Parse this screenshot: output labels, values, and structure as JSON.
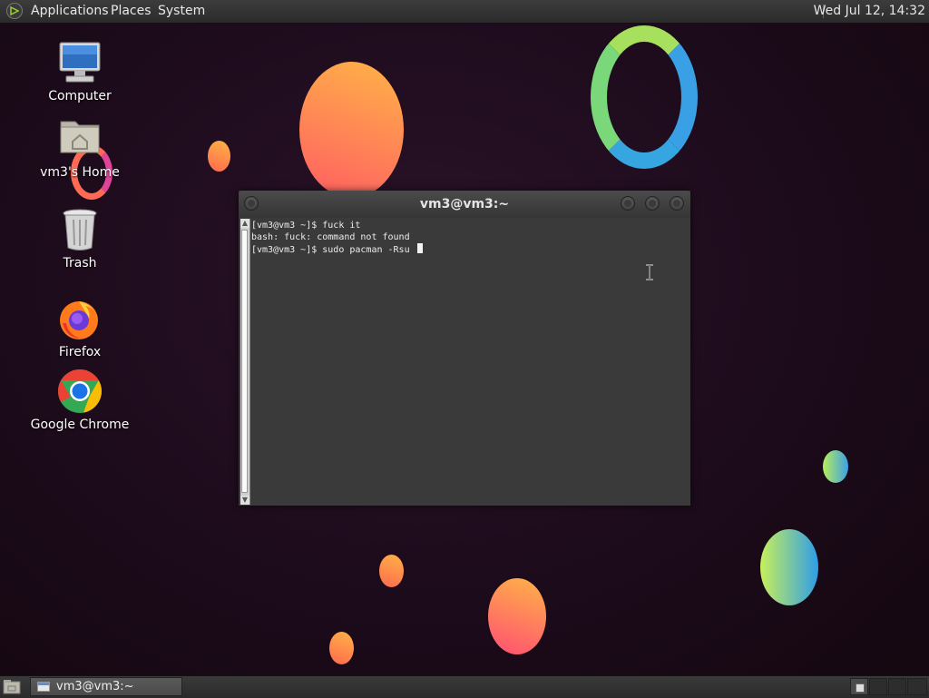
{
  "top_panel": {
    "menus": [
      "Applications",
      "Places",
      "System"
    ],
    "clock": "Wed Jul 12, 14:32"
  },
  "desktop_icons": [
    {
      "label": "Computer",
      "icon": "computer-icon"
    },
    {
      "label": "vm3's Home",
      "icon": "home-folder-icon"
    },
    {
      "label": "Trash",
      "icon": "trash-icon"
    },
    {
      "label": "Firefox",
      "icon": "firefox-icon"
    },
    {
      "label": "Google Chrome",
      "icon": "chrome-icon"
    }
  ],
  "terminal": {
    "title": "vm3@vm3:~",
    "lines": [
      "[vm3@vm3 ~]$ fuck it",
      "bash: fuck: command not found",
      "[vm3@vm3 ~]$ sudo pacman -Rsu "
    ]
  },
  "taskbar": {
    "tasks": [
      {
        "label": "vm3@vm3:~",
        "icon": "terminal-window-icon"
      }
    ]
  },
  "colors": {
    "panel": "#2e2e2e",
    "terminal_bg": "#3a3a3a",
    "desktop_bg": "#1c0b1b"
  }
}
